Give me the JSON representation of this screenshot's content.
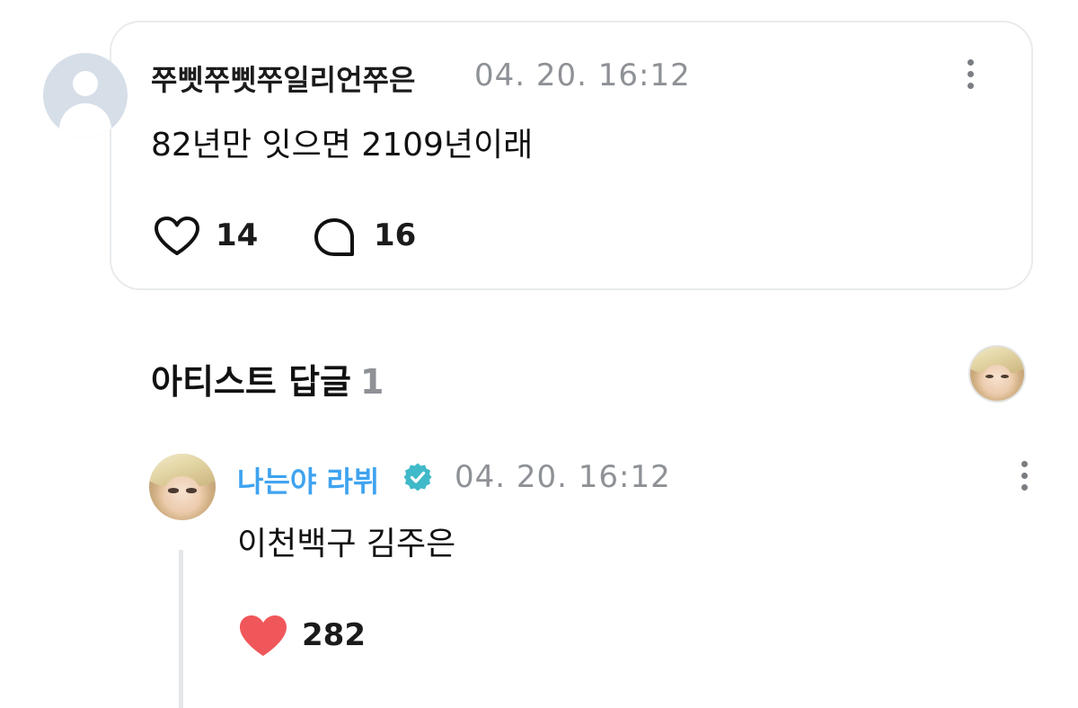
{
  "comment": {
    "username": "쭈삣쭈삣쭈일리언쭈은",
    "timestamp": "04. 20. 16:12",
    "text": "82년만 잇으면 2109년이래",
    "like_count": "14",
    "reply_count": "16",
    "icons": {
      "avatar": "default-user-avatar-icon",
      "more": "more-vertical-icon",
      "like": "heart-outline-icon",
      "reply": "speech-bubble-icon"
    }
  },
  "artist_replies": {
    "title": "아티스트 답글",
    "count": "1",
    "reply": {
      "name": "나는야 라뷔",
      "verified": true,
      "timestamp": "04. 20. 16:12",
      "text": "이천백구 김주은",
      "like_count": "282",
      "liked": true
    }
  },
  "colors": {
    "artist_name": "#3fa3f0",
    "verified_badge": "#40b9c8",
    "liked_heart": "#f0575a",
    "muted_text": "#8e9196",
    "card_border": "#e9ebee"
  }
}
